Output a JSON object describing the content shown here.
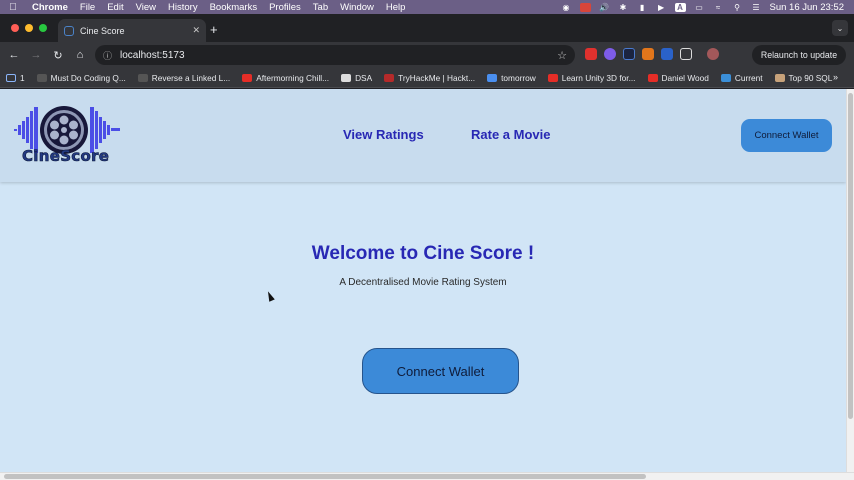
{
  "menubar": {
    "app": "Chrome",
    "items": [
      "File",
      "Edit",
      "View",
      "History",
      "Bookmarks",
      "Profiles",
      "Tab",
      "Window",
      "Help"
    ],
    "clock": "Sun 16 Jun  23:52"
  },
  "browser": {
    "tab_title": "Cine Score",
    "url": "localhost:5173",
    "relaunch_label": "Relaunch to update",
    "bookmarks": [
      "1",
      "Must Do Coding Q...",
      "Reverse a Linked L...",
      "Aftermorning Chill...",
      "DSA",
      "TryHackMe | Hackt...",
      "tomorrow",
      "Learn Unity 3D for...",
      "Daniel Wood",
      "Current",
      "Top 90 SQL"
    ]
  },
  "site": {
    "logo_text": "CineScore",
    "nav": [
      "View Ratings",
      "Rate a Movie"
    ],
    "header_button": "Connect Wallet",
    "hero_title": "Welcome to Cine Score !",
    "hero_subtitle": "A Decentralised Movie Rating System",
    "hero_button": "Connect Wallet"
  },
  "colors": {
    "page_bg": "#d1e5f6",
    "header_bg": "#c8dcee",
    "accent_text": "#2828b4",
    "button_bg": "#3c8ad8",
    "logo_waveform": "#4b4ee6"
  }
}
